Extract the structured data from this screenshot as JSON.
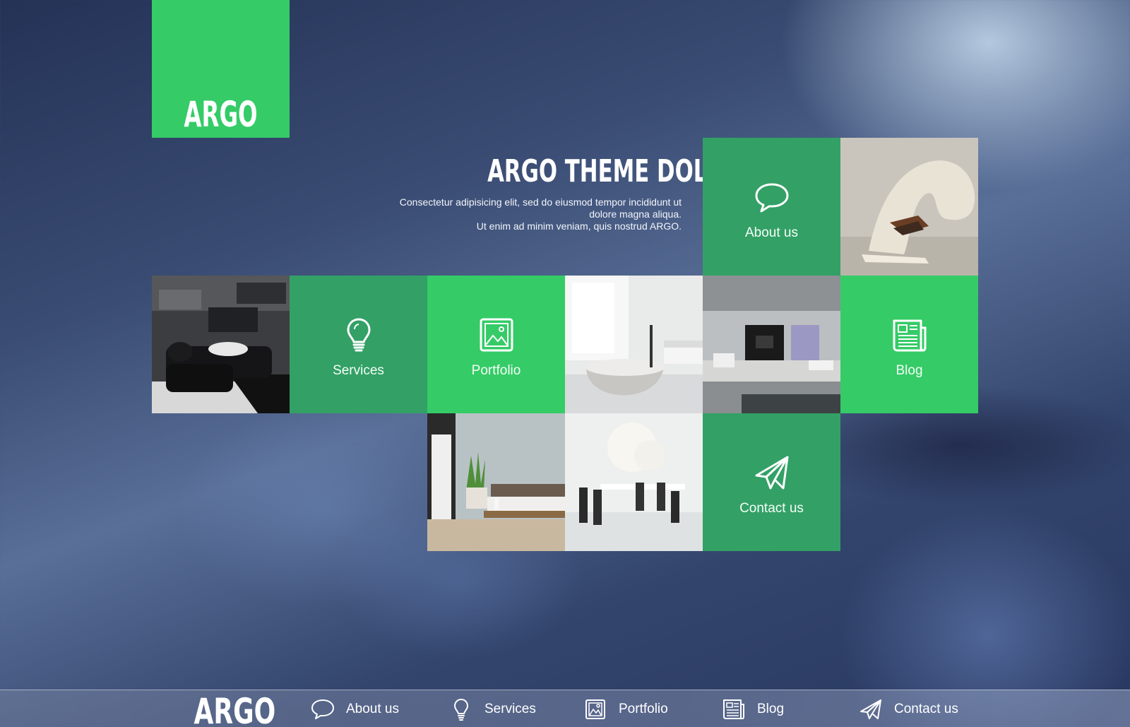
{
  "brand": {
    "logo_text": "ARGO",
    "color": "#35cb67",
    "dark_green": "#33a066"
  },
  "hero": {
    "headline": "ARGO THEME DOLOR SIT AMET ELASDE",
    "subtext_line1": "Consectetur adipisicing elit, sed do eiusmod tempor incididunt ut",
    "subtext_line2": "dolore magna aliqua.",
    "subtext_line3": "Ut enim ad minim veniam, quis nostrud ARGO."
  },
  "tiles": {
    "about": {
      "label": "About us",
      "icon": "speech-bubble-icon"
    },
    "services": {
      "label": "Services",
      "icon": "lightbulb-icon"
    },
    "portfolio": {
      "label": "Portfolio",
      "icon": "picture-icon"
    },
    "blog": {
      "label": "Blog",
      "icon": "newspaper-icon"
    },
    "contact": {
      "label": "Contact us",
      "icon": "paper-plane-icon"
    }
  },
  "bottom_nav": {
    "logo": "ARGO",
    "items": [
      {
        "label": "About us",
        "icon": "speech-bubble-icon"
      },
      {
        "label": "Services",
        "icon": "lightbulb-icon"
      },
      {
        "label": "Portfolio",
        "icon": "picture-icon"
      },
      {
        "label": "Blog",
        "icon": "newspaper-icon"
      },
      {
        "label": "Contact us",
        "icon": "paper-plane-icon"
      }
    ]
  }
}
